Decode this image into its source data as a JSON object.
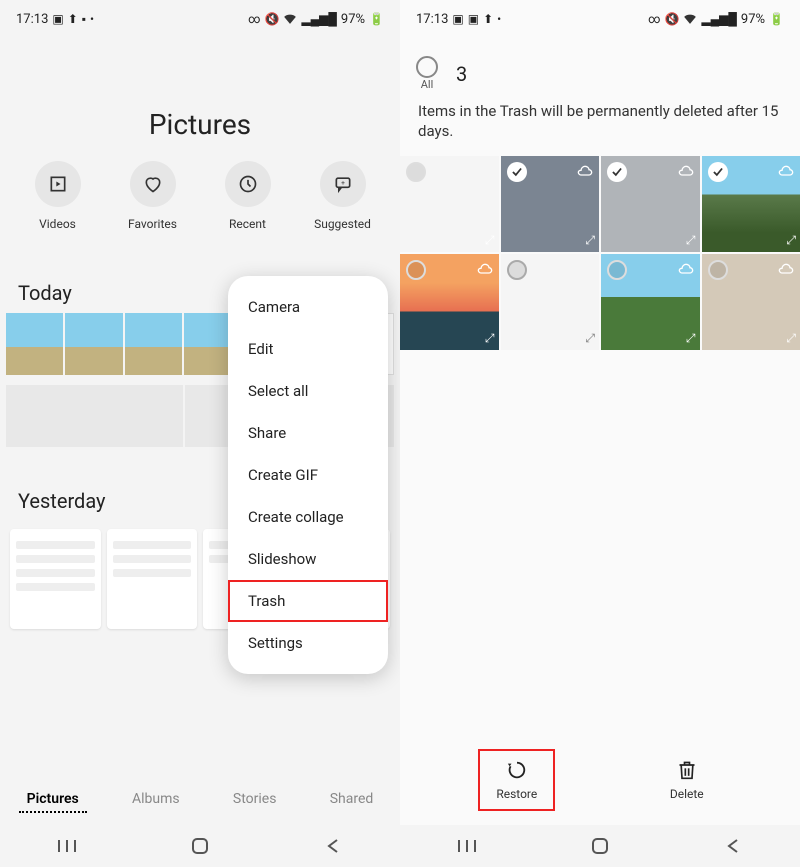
{
  "left": {
    "status": {
      "time": "17:13",
      "battery": "97%"
    },
    "title": "Pictures",
    "shortcuts": [
      {
        "label": "Videos",
        "icon": "play"
      },
      {
        "label": "Favorites",
        "icon": "heart"
      },
      {
        "label": "Recent",
        "icon": "clock"
      },
      {
        "label": "Suggested",
        "icon": "speech"
      }
    ],
    "section1": "Today",
    "section2": "Yesterday",
    "tabs": [
      "Pictures",
      "Albums",
      "Stories",
      "Shared"
    ],
    "menu": [
      "Camera",
      "Edit",
      "Select all",
      "Share",
      "Create GIF",
      "Create collage",
      "Slideshow",
      "Trash",
      "Settings"
    ],
    "menu_highlight": "Trash"
  },
  "right": {
    "status": {
      "time": "17:13",
      "battery": "97%"
    },
    "selected_count": "3",
    "all_label": "All",
    "trash_notice": "Items in the Trash will be permanently deleted after 15 days.",
    "items": [
      {
        "selected": false
      },
      {
        "selected": true
      },
      {
        "selected": true
      },
      {
        "selected": true
      },
      {
        "selected": false
      },
      {
        "selected": false
      },
      {
        "selected": false
      },
      {
        "selected": false
      }
    ],
    "actions": {
      "restore": "Restore",
      "delete": "Delete"
    },
    "action_highlight": "Restore"
  }
}
